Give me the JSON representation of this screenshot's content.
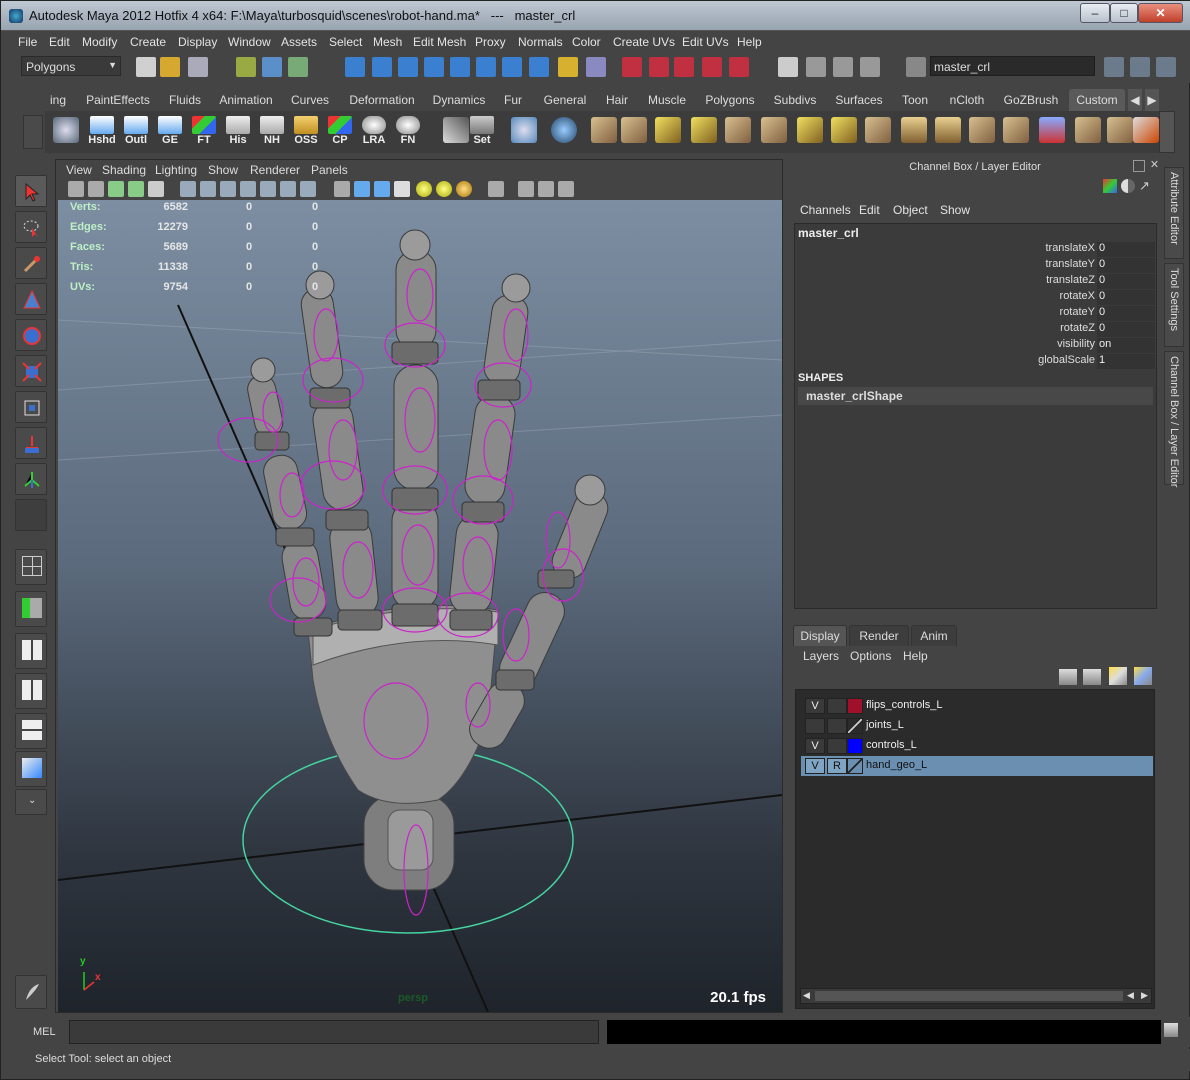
{
  "title": {
    "text": "Autodesk Maya 2012 Hotfix 4 x64: F:\\Maya\\turbosquid\\scenes\\robot-hand.ma*   ---   master_crl",
    "minimize": "–",
    "maximize": "□",
    "close": "✕"
  },
  "menubar": [
    "File",
    "Edit",
    "Modify",
    "Create",
    "Display",
    "Window",
    "Assets",
    "Select",
    "Mesh",
    "Edit Mesh",
    "Proxy",
    "Normals",
    "Color",
    "Create UVs",
    "Edit UVs",
    "Help"
  ],
  "status": {
    "menuset": "Polygons",
    "object_field": "master_crl"
  },
  "shelf_tabs": [
    "ing",
    "PaintEffects",
    "Fluids",
    "Animation",
    "Curves",
    "Deformation",
    "Dynamics",
    "Fur",
    "General",
    "Hair",
    "Muscle",
    "Polygons",
    "Subdivs",
    "Surfaces",
    "Toon",
    "nCloth",
    "GoZBrush",
    "Custom"
  ],
  "shelf_active_tab": "Custom",
  "shelf_buttons": [
    {
      "label": "Hshd",
      "icon": "hypershade-icon"
    },
    {
      "label": "Outl",
      "icon": "outliner-icon"
    },
    {
      "label": "GE",
      "icon": "graph-editor-icon"
    },
    {
      "label": "FT",
      "icon": "freeze-transform-icon"
    },
    {
      "label": "His",
      "icon": "history-icon"
    },
    {
      "label": "NH",
      "icon": "no-history-icon"
    },
    {
      "label": "OSS",
      "icon": "folder-icon"
    },
    {
      "label": "CP",
      "icon": "center-pivot-icon"
    },
    {
      "label": "LRA",
      "icon": "local-rotation-axes-icon"
    },
    {
      "label": "FN",
      "icon": "face-normals-icon"
    },
    {
      "label": "Set",
      "icon": "set-icon"
    }
  ],
  "viewport_menu": [
    "View",
    "Shading",
    "Lighting",
    "Show",
    "Renderer",
    "Panels"
  ],
  "hud": {
    "rows": [
      {
        "label": "Verts:",
        "v1": "6582",
        "v2": "0",
        "v3": "0"
      },
      {
        "label": "Edges:",
        "v1": "12279",
        "v2": "0",
        "v3": "0"
      },
      {
        "label": "Faces:",
        "v1": "5689",
        "v2": "0",
        "v3": "0"
      },
      {
        "label": "Tris:",
        "v1": "11338",
        "v2": "0",
        "v3": "0"
      },
      {
        "label": "UVs:",
        "v1": "9754",
        "v2": "0",
        "v3": "0"
      }
    ],
    "fps": "20.1 fps",
    "camera": "persp",
    "axis_y": "y",
    "axis_x": "x"
  },
  "channel_box": {
    "title": "Channel Box / Layer Editor",
    "menu": [
      "Channels",
      "Edit",
      "Object",
      "Show"
    ],
    "object": "master_crl",
    "attributes": [
      {
        "name": "translateX",
        "value": "0"
      },
      {
        "name": "translateY",
        "value": "0"
      },
      {
        "name": "translateZ",
        "value": "0"
      },
      {
        "name": "rotateX",
        "value": "0"
      },
      {
        "name": "rotateY",
        "value": "0"
      },
      {
        "name": "rotateZ",
        "value": "0"
      },
      {
        "name": "visibility",
        "value": "on"
      },
      {
        "name": "globalScale",
        "value": "1"
      }
    ],
    "shapes_header": "SHAPES",
    "shape": "master_crlShape"
  },
  "side_tabs": [
    "Attribute Editor",
    "Tool Settings",
    "Channel Box / Layer Editor"
  ],
  "layer_editor": {
    "tabs": [
      "Display",
      "Render",
      "Anim"
    ],
    "active_tab": "Display",
    "menu": [
      "Layers",
      "Options",
      "Help"
    ],
    "layers": [
      {
        "v": "V",
        "r": "",
        "color": "#a0102a",
        "name": "flips_controls_L",
        "selected": false
      },
      {
        "v": "",
        "r": "",
        "color": "none",
        "name": "joints_L",
        "selected": false
      },
      {
        "v": "V",
        "r": "",
        "color": "#0000ff",
        "name": "controls_L",
        "selected": false
      },
      {
        "v": "V",
        "r": "R",
        "color": "none",
        "name": "hand_geo_L",
        "selected": true
      }
    ]
  },
  "command_line": {
    "mode": "MEL"
  },
  "help_line": "Select Tool: select an object",
  "colors": {
    "ui_bg": "#444444",
    "selection": "#6b8fb0",
    "wire_magenta": "#cc22cc",
    "ring_green": "#44d4a0"
  }
}
